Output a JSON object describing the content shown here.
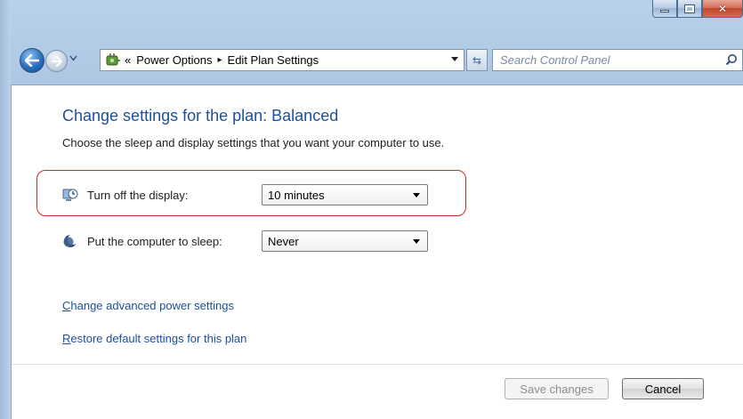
{
  "window": {
    "controls": {
      "minimize_icon": "minimize-icon",
      "maximize_icon": "maximize-icon",
      "close_glyph": "✕"
    }
  },
  "nav": {
    "breadcrumb_prefix": "«",
    "breadcrumb": [
      "Power Options",
      "Edit Plan Settings"
    ],
    "separator": "▸",
    "search_placeholder": "Search Control Panel",
    "refresh_glyph": "⇆"
  },
  "main": {
    "title": "Change settings for the plan: Balanced",
    "subtitle": "Choose the sleep and display settings that you want your computer to use.",
    "settings": [
      {
        "label": "Turn off the display:",
        "value": "10 minutes",
        "icon": "display-clock-icon"
      },
      {
        "label": "Put the computer to sleep:",
        "value": "Never",
        "icon": "moon-sleep-icon"
      }
    ],
    "links": {
      "advanced_first": "C",
      "advanced_rest": "hange advanced power settings",
      "restore_first": "R",
      "restore_rest": "estore default settings for this plan"
    }
  },
  "footer": {
    "save_label": "Save changes",
    "cancel_label": "Cancel"
  },
  "colors": {
    "accent_blue": "#1e4f9c",
    "highlight_red": "#d12a2a"
  }
}
